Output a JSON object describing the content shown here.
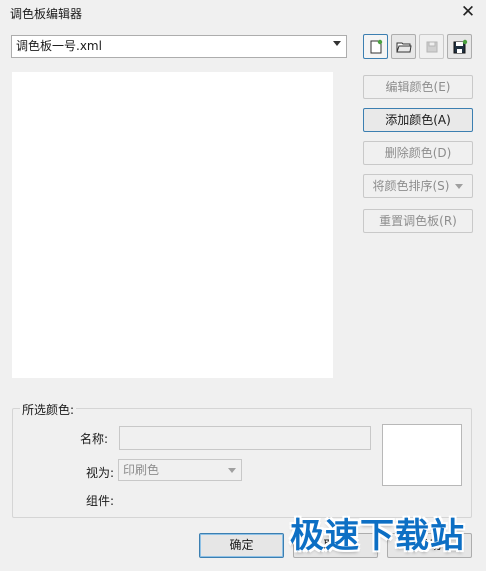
{
  "window": {
    "title": "调色板编辑器",
    "close_glyph": "✕"
  },
  "palette_select": {
    "value": "调色板一号.xml"
  },
  "toolbar": {
    "icons": [
      "new-palette-icon",
      "open-folder-icon",
      "save-icon",
      "save-as-icon"
    ]
  },
  "actions": {
    "edit_color": "编辑颜色(E)",
    "add_color": "添加颜色(A)",
    "delete_color": "删除颜色(D)",
    "sort_colors": "将颜色排序(S)",
    "reset_palette": "重置调色板(R)"
  },
  "selected_color": {
    "group_label": "所选颜色:",
    "name_label": "名称:",
    "name_value": "",
    "view_as_label": "视为:",
    "view_as_value": "印刷色",
    "components_label": "组件:"
  },
  "footer": {
    "ok": "确定",
    "cancel": "取消",
    "help": "帮助"
  },
  "watermark": {
    "text": "极速下载站"
  },
  "colors": {
    "accent_border": "#3c7fb1",
    "watermark": "#0d6fc4"
  }
}
